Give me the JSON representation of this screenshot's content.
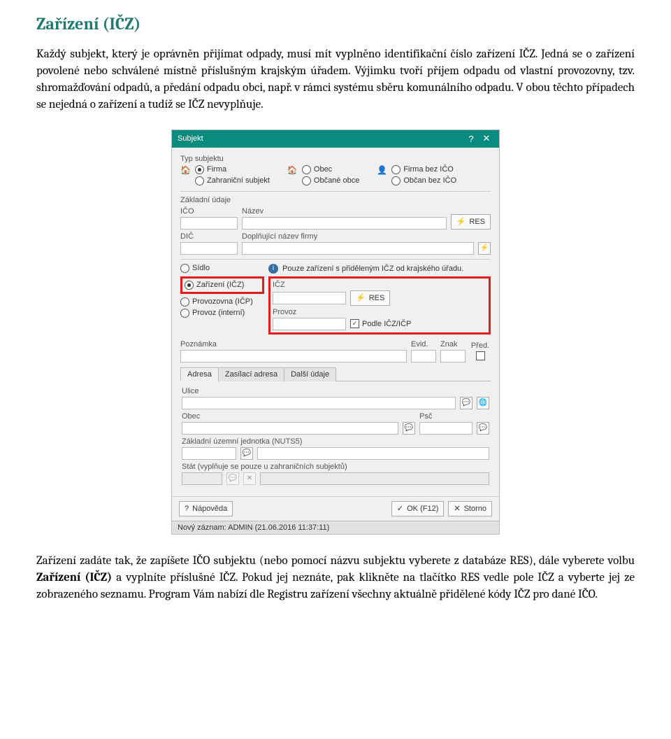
{
  "heading": "Zařízení (IČZ)",
  "para1": "Každý subjekt, který je oprávněn přijímat odpady, musí mít vyplněno identifikační číslo zařízení IČZ. Jedná se o zařízení povolené nebo schválené místně příslušným krajským úřadem. Výjimku tvoří příjem odpadu od vlastní provozovny, tzv. shromažďování odpadů, a předání odpadu obci, např. v rámci systému sběru komunálního odpadu. V obou těchto případech se nejedná o zařízení a tudíž se IČZ nevyplňuje.",
  "para2_a": "Zařízení zadáte tak, že zapíšete IČO subjektu (nebo pomocí názvu subjektu vyberete z databáze RES), dále vyberete volbu ",
  "para2_bold": "Zařízení (IČZ)",
  "para2_b": " a vyplníte příslušné IČZ. Pokud jej neznáte, pak klikněte na tlačítko RES vedle pole IČZ a vyberte jej ze zobrazeného seznamu. Program Vám nabízí dle Registru zařízení všechny aktuálně přidělené kódy IČZ pro dané IČO.",
  "win": {
    "title": "Subjekt",
    "help": "?",
    "close": "✕",
    "typ_subjektu": "Typ subjektu",
    "firma": "Firma",
    "zahr": "Zahraniční subjekt",
    "obec": "Obec",
    "obcane": "Občané obce",
    "firma_bez": "Firma bez IČO",
    "obcan_bez": "Občan bez IČO",
    "zaklad": "Základní údaje",
    "ico": "IČO",
    "nazev": "Název",
    "res": "RES",
    "dic": "DIČ",
    "dopl": "Doplňující název firmy",
    "info": "Pouze zařízení s přiděleným IČZ od krajského úřadu.",
    "sidlo": "Sídlo",
    "zarizeni": "Zařízení (IČZ)",
    "provozovna": "Provozovna (IČP)",
    "provoz_int": "Provoz (interní)",
    "icz": "IČZ",
    "provoz": "Provoz",
    "podle": "Podle IČZ/IČP",
    "poznamka": "Poznámka",
    "evid": "Evid.",
    "znak": "Znak",
    "pred": "Před.",
    "adresa": "Adresa",
    "zasil": "Zasílací adresa",
    "dalsi": "Další údaje",
    "ulice": "Ulice",
    "obec_f": "Obec",
    "psc": "Psč",
    "nuts": "Základní územní jednotka (NUTS5)",
    "stat": "Stát (vyplňuje se pouze u zahraničních subjektů)",
    "napoveda": "Nápověda",
    "ok": "OK (F12)",
    "storno": "Storno",
    "status": "Nový záznam: ADMIN (21.06.2016 11:37:11)"
  }
}
